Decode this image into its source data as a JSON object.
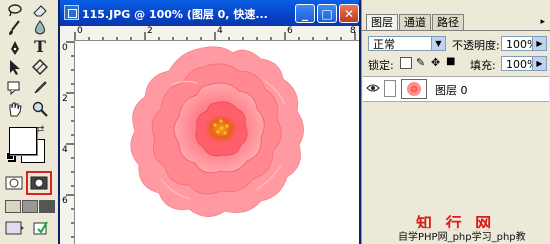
{
  "document": {
    "title": "115.JPG @ 100% (图层 0, 快速...",
    "window_buttons": {
      "minimize": "_",
      "maximize": "□",
      "close": "✕"
    },
    "ruler_top_labels": [
      "0",
      "2",
      "4",
      "6",
      "8"
    ],
    "ruler_left_labels": [
      "0",
      "2",
      "4",
      "6"
    ]
  },
  "layers_panel": {
    "tabs": [
      "图层",
      "通道",
      "路径"
    ],
    "blend_mode": "正常",
    "opacity_label": "不透明度:",
    "opacity_value": "100%",
    "lock_label": "锁定:",
    "fill_label": "填充:",
    "fill_value": "100%",
    "layers": [
      {
        "name": "图层 0",
        "visible": true
      }
    ]
  },
  "watermark": {
    "big": "知 行 网",
    "small": "自学PHP网_php学习_php教"
  },
  "toolbox": {
    "tools": [
      "lasso-icon",
      "magic-wand-icon",
      "brush-icon",
      "text-icon",
      "pen-icon",
      "path-select-icon",
      "hand-icon",
      "zoom-icon",
      "eyedropper-icon",
      "shape-icon"
    ],
    "quick_mask_active": true,
    "highlight_color": "#e02020"
  }
}
